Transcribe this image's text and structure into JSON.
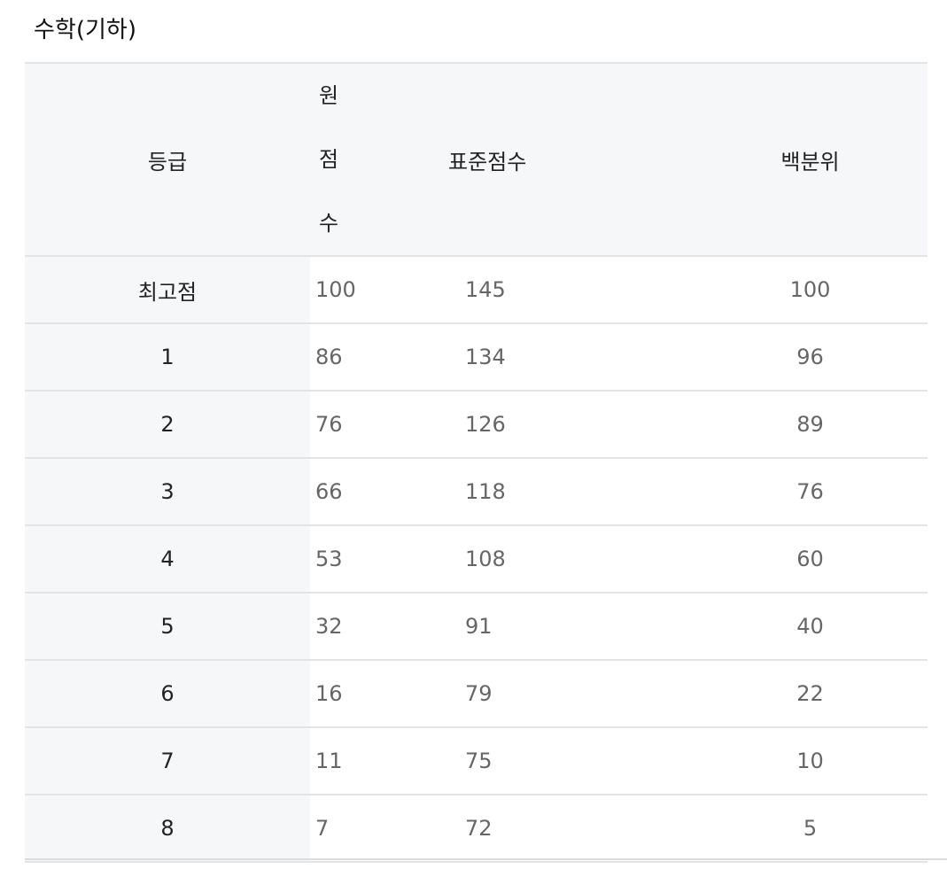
{
  "title": "수학(기하)",
  "table": {
    "headers": {
      "grade": "등급",
      "raw": "원점수",
      "standard": "표준점수",
      "percentile": "백분위"
    },
    "rows": [
      {
        "grade": "최고점",
        "raw": "100",
        "standard": "145",
        "percentile": "100"
      },
      {
        "grade": "1",
        "raw": "86",
        "standard": "134",
        "percentile": "96"
      },
      {
        "grade": "2",
        "raw": "76",
        "standard": "126",
        "percentile": "89"
      },
      {
        "grade": "3",
        "raw": "66",
        "standard": "118",
        "percentile": "76"
      },
      {
        "grade": "4",
        "raw": "53",
        "standard": "108",
        "percentile": "60"
      },
      {
        "grade": "5",
        "raw": "32",
        "standard": "91",
        "percentile": "40"
      },
      {
        "grade": "6",
        "raw": "16",
        "standard": "79",
        "percentile": "22"
      },
      {
        "grade": "7",
        "raw": "11",
        "standard": "75",
        "percentile": "10"
      },
      {
        "grade": "8",
        "raw": "7",
        "standard": "72",
        "percentile": "5"
      }
    ]
  }
}
